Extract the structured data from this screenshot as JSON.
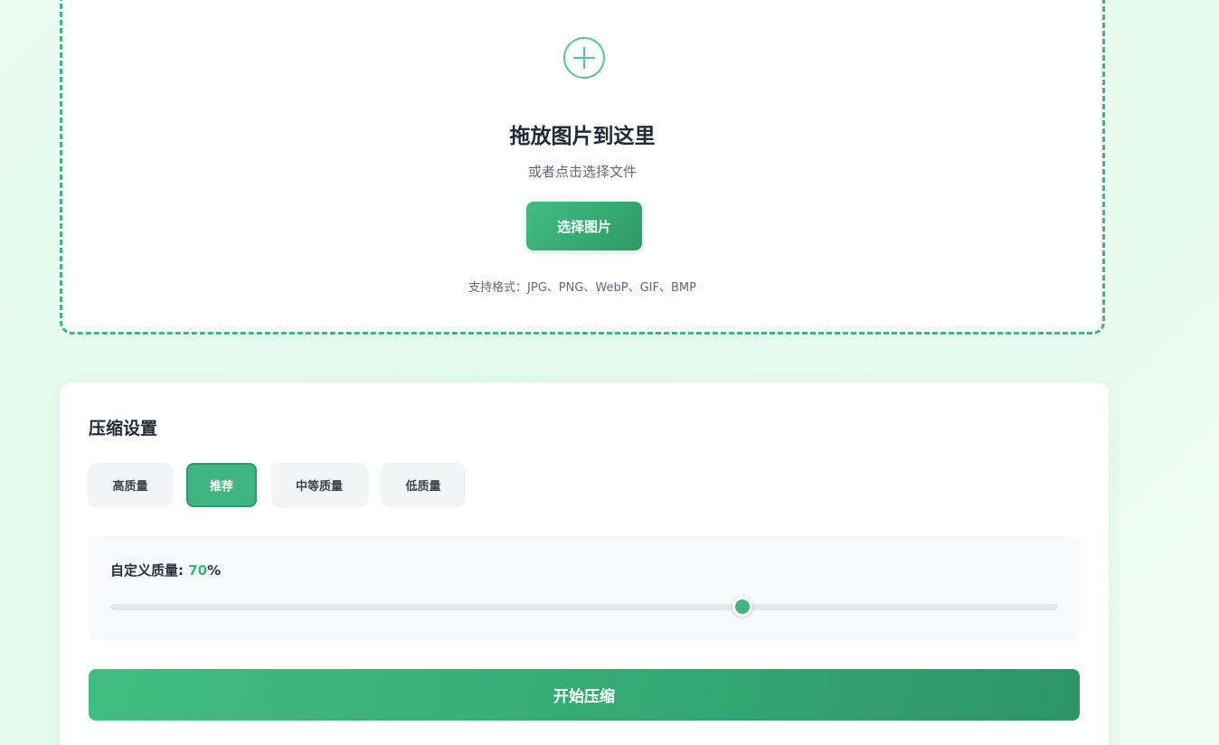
{
  "upload": {
    "icon": "plus-circle-icon",
    "title": "拖放图片到这里",
    "subtitle": "或者点击选择文件",
    "button_label": "选择图片",
    "formats_text": "支持格式：JPG、PNG、WebP、GIF、BMP"
  },
  "settings": {
    "title": "压缩设置",
    "presets": [
      {
        "label": "高质量",
        "active": false
      },
      {
        "label": "推荐",
        "active": true
      },
      {
        "label": "中等质量",
        "active": false
      },
      {
        "label": "低质量",
        "active": false
      }
    ],
    "quality_label": "自定义质量: ",
    "quality_value": "70",
    "quality_unit": "%",
    "quality_percent": 70,
    "start_button_label": "开始压缩"
  },
  "colors": {
    "accent": "#3fb67f",
    "accent_dark": "#2e9a66"
  }
}
